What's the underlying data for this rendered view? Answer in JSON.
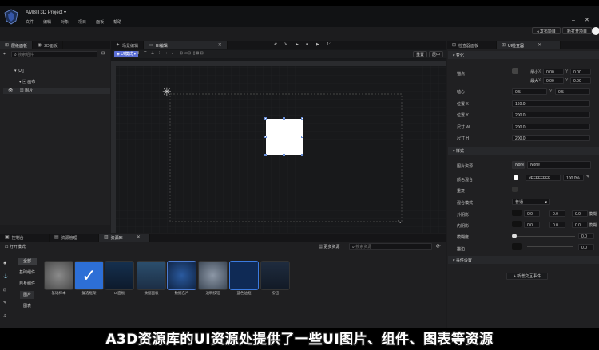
{
  "app": {
    "project_title": "AMBIT3D Project",
    "menu": [
      "文件",
      "编辑",
      "对象",
      "项目",
      "面板",
      "帮助"
    ],
    "publish_button": "发布项目",
    "open_new_button": "新打开项目"
  },
  "left_panel": {
    "tabs": [
      "层级面板",
      "2D面板"
    ],
    "search_placeholder": "搜索组件",
    "tree": [
      "[UI]",
      "画布",
      "图片"
    ]
  },
  "center": {
    "tabs": [
      "场景编辑",
      "UI编辑"
    ],
    "mode_label": "UI模式",
    "play_label": "1:1",
    "right_buttons": [
      "重置",
      "居中"
    ]
  },
  "bottom": {
    "tabs": [
      "控制台",
      "资源管理",
      "资源库"
    ],
    "toggle_label": "打开模式",
    "more_button": "更多资源",
    "search_placeholder": "搜索资源",
    "categories": [
      "全部",
      "基础组件",
      "自身组件",
      "图片",
      "图表"
    ],
    "assets": [
      "基础样本",
      "复选框架",
      "UI面板",
      "数据面板",
      "数据名片",
      "透明按钮",
      "蓝色边框",
      "按钮"
    ]
  },
  "inspector": {
    "tabs": [
      "检查器面板",
      "UI检查器"
    ],
    "section_transform": "变化",
    "anchor_label": "锚点",
    "anchor_min_x_label": "最小",
    "anchor_min_x": "0.00",
    "anchor_min_y": "0.00",
    "anchor_max_label": "最大",
    "anchor_max_x": "0.00",
    "anchor_max_y": "0.00",
    "pivot_label": "轴心",
    "pivot_x": "0.5",
    "pivot_y": "0.5",
    "pos_x_label": "位置 X",
    "pos_x": "160.0",
    "pos_y_label": "位置 Y",
    "pos_y": "200.0",
    "width_label": "尺寸 W",
    "width": "200.0",
    "height_label": "尺寸 H",
    "height": "200.0",
    "section_style": "样式",
    "image_label": "图片资源",
    "image_none_btn": "None",
    "image_value": "None",
    "color_label": "颜色混合",
    "color_value": "#FFFFFFFF",
    "color_percent": "100.0%",
    "repeat_label": "重复",
    "blend_label": "混合模式",
    "blend_value": "普通",
    "outer_shadow_label": "外阴影",
    "inner_shadow_label": "内阴影",
    "shadow_values": [
      "0.0",
      "0.0",
      "0.0",
      "0.0"
    ],
    "shadow_unit": "模糊",
    "blur_label": "模糊度",
    "blur_value": "0.0",
    "border_label": "描边",
    "border_value": "0.0",
    "section_events": "事件设置",
    "add_event_button": "+ 新增交互事件"
  },
  "subtitle": "A3D资源库的UI资源处提供了一些UI图片、组件、图表等资源",
  "colors": {
    "accent": "#5b6fd6",
    "panel": "#202022",
    "canvas": "#1b1c1e"
  }
}
